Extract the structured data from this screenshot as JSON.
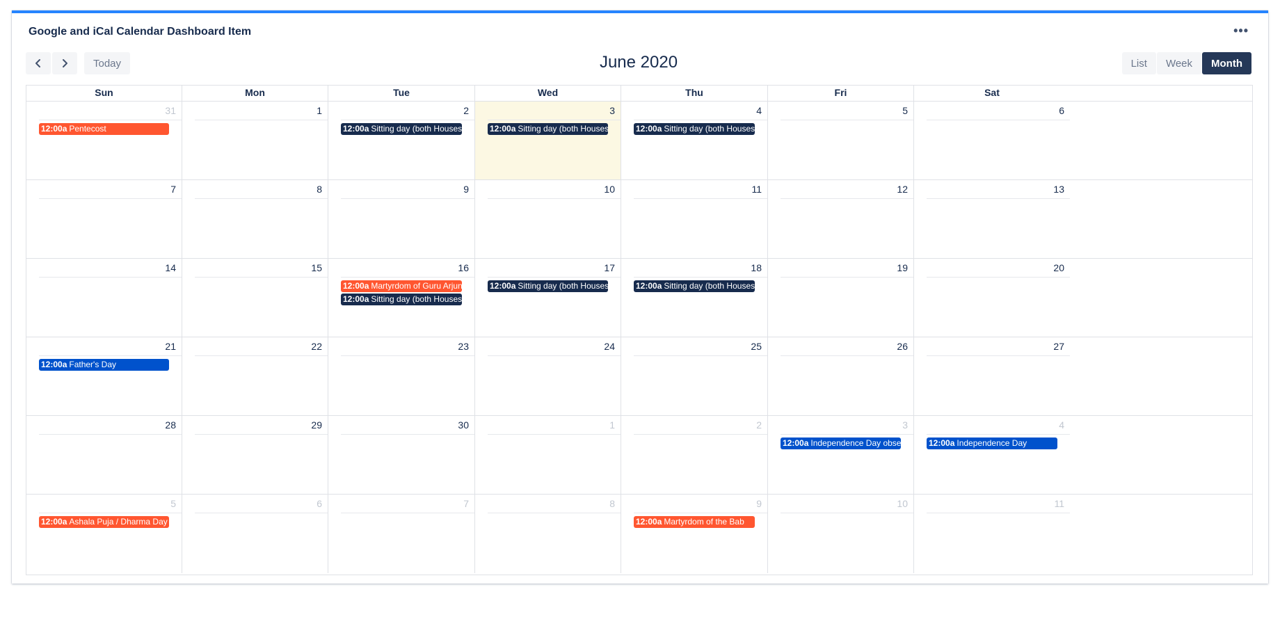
{
  "gadget": {
    "title": "Google and iCal Calendar Dashboard Item"
  },
  "toolbar": {
    "prev_icon": "chevron-left-icon",
    "next_icon": "chevron-right-icon",
    "today_label": "Today",
    "title": "June 2020",
    "views": [
      "List",
      "Week",
      "Month"
    ],
    "active_view": "Month"
  },
  "colors": {
    "accent": "#2684ff",
    "orange_event": "#ff5630",
    "navy_event": "#172b4d",
    "blue_event": "#0052cc",
    "today_bg": "#fcf8e3"
  },
  "calendar": {
    "weekdays": [
      "Sun",
      "Mon",
      "Tue",
      "Wed",
      "Thu",
      "Fri",
      "Sat"
    ],
    "weeks": [
      [
        {
          "num": "31",
          "other": true,
          "events": [
            {
              "time": "12:00a",
              "title": "Pentecost",
              "color": "orange"
            }
          ]
        },
        {
          "num": "1",
          "events": []
        },
        {
          "num": "2",
          "events": [
            {
              "time": "12:00a",
              "title": "Sitting day (both Houses)",
              "color": "navy"
            }
          ]
        },
        {
          "num": "3",
          "today": true,
          "events": [
            {
              "time": "12:00a",
              "title": "Sitting day (both Houses)",
              "color": "navy"
            }
          ]
        },
        {
          "num": "4",
          "events": [
            {
              "time": "12:00a",
              "title": "Sitting day (both Houses)",
              "color": "navy"
            }
          ]
        },
        {
          "num": "5",
          "events": []
        },
        {
          "num": "6",
          "events": []
        }
      ],
      [
        {
          "num": "7",
          "events": []
        },
        {
          "num": "8",
          "events": []
        },
        {
          "num": "9",
          "events": []
        },
        {
          "num": "10",
          "events": []
        },
        {
          "num": "11",
          "events": []
        },
        {
          "num": "12",
          "events": []
        },
        {
          "num": "13",
          "events": []
        }
      ],
      [
        {
          "num": "14",
          "events": []
        },
        {
          "num": "15",
          "events": []
        },
        {
          "num": "16",
          "events": [
            {
              "time": "12:00a",
              "title": "Martyrdom of Guru Arjun Dev Ji",
              "color": "orange"
            },
            {
              "time": "12:00a",
              "title": "Sitting day (both Houses)",
              "color": "navy"
            }
          ]
        },
        {
          "num": "17",
          "events": [
            {
              "time": "12:00a",
              "title": "Sitting day (both Houses)",
              "color": "navy"
            }
          ]
        },
        {
          "num": "18",
          "events": [
            {
              "time": "12:00a",
              "title": "Sitting day (both Houses)",
              "color": "navy"
            }
          ]
        },
        {
          "num": "19",
          "events": []
        },
        {
          "num": "20",
          "events": []
        }
      ],
      [
        {
          "num": "21",
          "events": [
            {
              "time": "12:00a",
              "title": "Father's Day",
              "color": "blue"
            }
          ]
        },
        {
          "num": "22",
          "events": []
        },
        {
          "num": "23",
          "events": []
        },
        {
          "num": "24",
          "events": []
        },
        {
          "num": "25",
          "events": []
        },
        {
          "num": "26",
          "events": []
        },
        {
          "num": "27",
          "events": []
        }
      ],
      [
        {
          "num": "28",
          "events": []
        },
        {
          "num": "29",
          "events": []
        },
        {
          "num": "30",
          "events": []
        },
        {
          "num": "1",
          "other": true,
          "events": []
        },
        {
          "num": "2",
          "other": true,
          "events": []
        },
        {
          "num": "3",
          "other": true,
          "events": [
            {
              "time": "12:00a",
              "title": "Independence Day observed",
              "color": "blue"
            }
          ]
        },
        {
          "num": "4",
          "other": true,
          "events": [
            {
              "time": "12:00a",
              "title": "Independence Day",
              "color": "blue"
            }
          ]
        }
      ],
      [
        {
          "num": "5",
          "other": true,
          "events": [
            {
              "time": "12:00a",
              "title": "Ashala Puja / Dharma Day",
              "color": "orange"
            }
          ]
        },
        {
          "num": "6",
          "other": true,
          "events": []
        },
        {
          "num": "7",
          "other": true,
          "events": []
        },
        {
          "num": "8",
          "other": true,
          "events": []
        },
        {
          "num": "9",
          "other": true,
          "events": [
            {
              "time": "12:00a",
              "title": "Martyrdom of the Bab",
              "color": "orange"
            }
          ]
        },
        {
          "num": "10",
          "other": true,
          "events": []
        },
        {
          "num": "11",
          "other": true,
          "events": []
        }
      ]
    ]
  }
}
